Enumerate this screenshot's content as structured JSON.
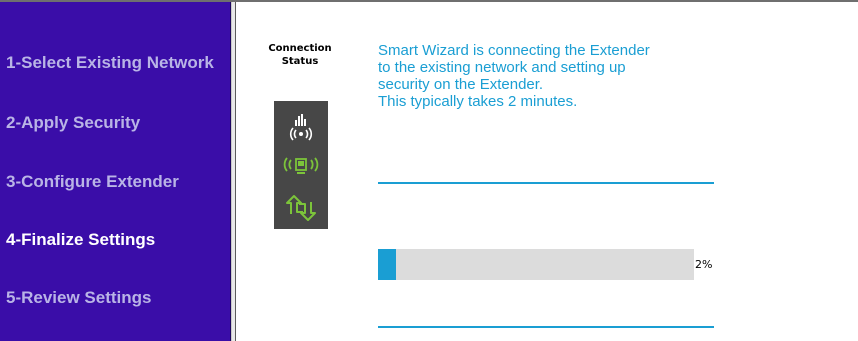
{
  "sidebar": {
    "items": [
      {
        "label": "1-Select Existing Network",
        "active": false
      },
      {
        "label": "2-Apply Security",
        "active": false
      },
      {
        "label": "3-Configure Extender",
        "active": false
      },
      {
        "label": "4-Finalize Settings",
        "active": true
      },
      {
        "label": "5-Review Settings",
        "active": false
      }
    ]
  },
  "status": {
    "title_line1": "Connection",
    "title_line2": "Status",
    "icons": [
      "wireless-signal-icon",
      "extender-device-icon",
      "transfer-arrows-icon"
    ],
    "colors": {
      "panel": "#474747",
      "icon_white": "#ffffff",
      "icon_green": "#7cc43a"
    }
  },
  "message": {
    "lines": [
      "Smart Wizard is connecting the Extender",
      "to the existing network and setting up",
      "security on the Extender.",
      "This typically takes 2 minutes."
    ]
  },
  "progress": {
    "percent": 2,
    "label": "2%"
  },
  "colors": {
    "sidebar_bg": "#3a0da8",
    "sidebar_text": "#b9b4e6",
    "sidebar_active_text": "#ffffff",
    "accent": "#1a9ed3",
    "progress_track": "#dcdcdc"
  }
}
